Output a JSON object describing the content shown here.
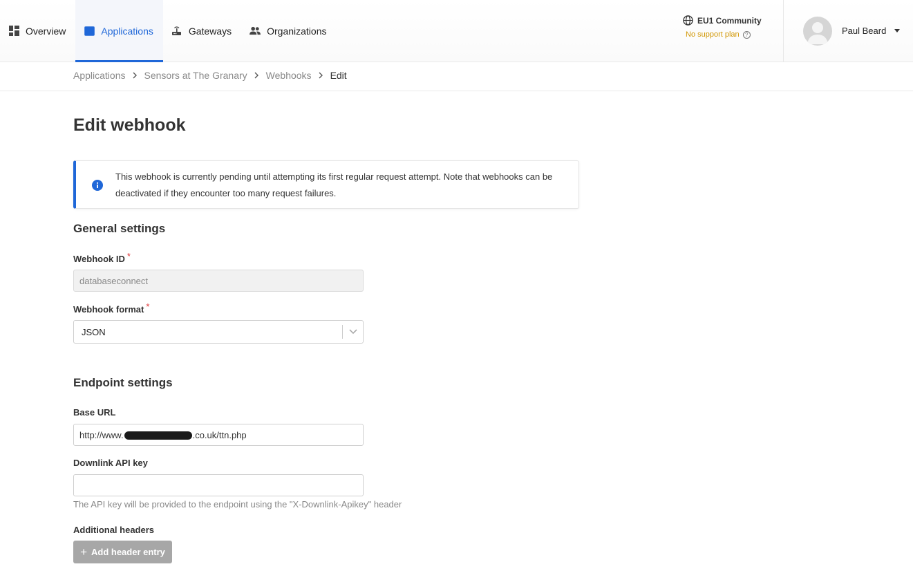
{
  "nav": {
    "items": [
      {
        "label": "Overview",
        "icon": "dashboard-icon",
        "active": false
      },
      {
        "label": "Applications",
        "icon": "window-icon",
        "active": true
      },
      {
        "label": "Gateways",
        "icon": "router-icon",
        "active": false
      },
      {
        "label": "Organizations",
        "icon": "people-icon",
        "active": false
      }
    ]
  },
  "cluster": {
    "name": "EU1 Community",
    "support": "No support plan",
    "support_help": "?"
  },
  "user": {
    "name": "Paul Beard"
  },
  "breadcrumb": [
    {
      "label": "Applications"
    },
    {
      "label": "Sensors at The Granary"
    },
    {
      "label": "Webhooks"
    },
    {
      "label": "Edit"
    }
  ],
  "page": {
    "title": "Edit webhook"
  },
  "notice": {
    "text": "This webhook is currently pending until attempting its first regular request attempt. Note that webhooks can be deactivated if they encounter too many request failures."
  },
  "general": {
    "title": "General settings",
    "webhook_id_label": "Webhook ID",
    "webhook_id_value": "databaseconnect",
    "format_label": "Webhook format",
    "format_value": "JSON",
    "required_mark": "*"
  },
  "endpoint": {
    "title": "Endpoint settings",
    "base_url_label": "Base URL",
    "base_url_prefix": "http://www.",
    "base_url_suffix": ".co.uk/ttn.php",
    "api_key_label": "Downlink API key",
    "api_key_value": "",
    "api_key_help": "The API key will be provided to the endpoint using the \"X-Downlink-Apikey\" header",
    "headers_label": "Additional headers",
    "add_header_label": "Add header entry"
  }
}
